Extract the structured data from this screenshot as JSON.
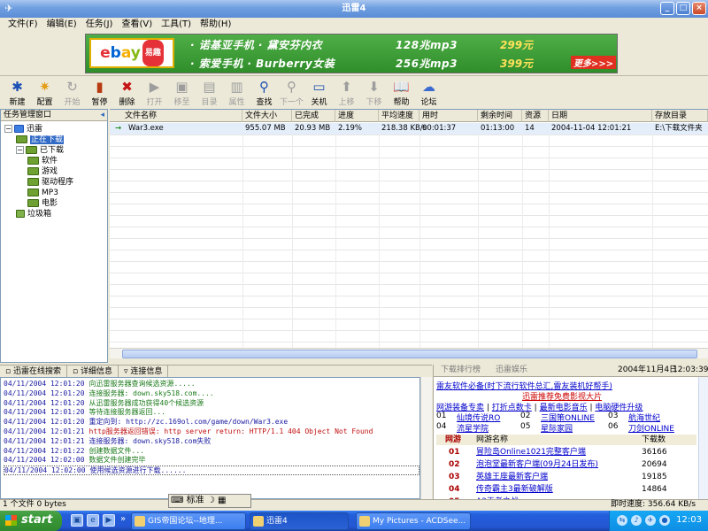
{
  "window": {
    "title": "迅雷4",
    "min": "_",
    "max": "□",
    "close": "×"
  },
  "menu": [
    "文件(F)",
    "编辑(E)",
    "任务(J)",
    "查看(V)",
    "工具(T)",
    "帮助(H)"
  ],
  "ad": {
    "logo_letters": [
      "e",
      "b",
      "a",
      "y"
    ],
    "logo_tag": "易趣",
    "line1": "· 诺基亚手机 · 黛安芬内衣",
    "line1_mp3": "128兆mp3",
    "line1_price": "299元",
    "line2": "· 索爱手机 · Burberry女装",
    "line2_mp3": "256兆mp3",
    "line2_price": "399元",
    "more": "更多>>>"
  },
  "toolbar": [
    {
      "label": "新建",
      "icon": "new-icon",
      "glyph": "✱",
      "enabled": true
    },
    {
      "label": "配置",
      "icon": "config-icon",
      "glyph": "✷",
      "enabled": true
    },
    {
      "label": "开始",
      "icon": "start-icon",
      "glyph": "↻",
      "enabled": false
    },
    {
      "label": "暂停",
      "icon": "pause-icon",
      "glyph": "▮",
      "enabled": true
    },
    {
      "label": "删除",
      "icon": "delete-icon",
      "glyph": "✖",
      "enabled": true
    },
    {
      "label": "打开",
      "icon": "open-icon",
      "glyph": "▶",
      "enabled": false
    },
    {
      "label": "移至",
      "icon": "move-icon",
      "glyph": "▣",
      "enabled": false
    },
    {
      "label": "目录",
      "icon": "folder-icon",
      "glyph": "▤",
      "enabled": false
    },
    {
      "label": "属性",
      "icon": "properties-icon",
      "glyph": "▥",
      "enabled": false
    },
    {
      "label": "查找",
      "icon": "find-icon",
      "glyph": "⚲",
      "enabled": true
    },
    {
      "label": "下一个",
      "icon": "next-icon",
      "glyph": "⚲",
      "enabled": false
    },
    {
      "label": "关机",
      "icon": "shutdown-icon",
      "glyph": "▭",
      "enabled": true
    },
    {
      "label": "上移",
      "icon": "move-up-icon",
      "glyph": "⬆",
      "enabled": false
    },
    {
      "label": "下移",
      "icon": "move-down-icon",
      "glyph": "⬇",
      "enabled": false
    },
    {
      "label": "帮助",
      "icon": "help-icon",
      "glyph": "📖",
      "enabled": true
    },
    {
      "label": "论坛",
      "icon": "forum-icon",
      "glyph": "☁",
      "enabled": true
    }
  ],
  "left": {
    "header": "任务管理窗口",
    "pin": "◂",
    "tree": [
      {
        "label": "迅雷",
        "level": 0,
        "expander": "−"
      },
      {
        "label": "正在下载",
        "level": 1,
        "selected": true
      },
      {
        "label": "已下载",
        "level": 1,
        "expander": "−"
      },
      {
        "label": "软件",
        "level": 2
      },
      {
        "label": "游戏",
        "level": 2
      },
      {
        "label": "驱动程序",
        "level": 2
      },
      {
        "label": "MP3",
        "level": 2
      },
      {
        "label": "电影",
        "level": 2
      },
      {
        "label": "垃圾箱",
        "level": 1
      }
    ]
  },
  "table": {
    "columns": [
      "文件名称",
      "文件大小",
      "已完成",
      "进度",
      "平均速度",
      "用时",
      "剩余时间",
      "资源",
      "日期",
      "存放目录"
    ],
    "rows": [
      [
        "→",
        "War3.exe",
        "955.07 MB",
        "20.93 MB",
        "2.19%",
        "218.38 KB/s",
        "00:01:37",
        "01:13:00",
        "14",
        "2004-11-04 12:01:21",
        "E:\\下载文件夹"
      ]
    ]
  },
  "logtabs": [
    "迅雷在线搜索",
    "详细信息",
    "连接信息"
  ],
  "log": [
    {
      "time": "04/11/2004 12:01:20",
      "msg": "向迅雷服务器查询候选资源.....",
      "color": "green"
    },
    {
      "time": "04/11/2004 12:01:20",
      "msg": "连接服务器: down.sky518.com....",
      "color": "green"
    },
    {
      "time": "04/11/2004 12:01:20",
      "msg": "从迅雷服务器成功获得40个候选资源",
      "color": "green"
    },
    {
      "time": "04/11/2004 12:01:20",
      "msg": "等待连接服务器返回...",
      "color": "green"
    },
    {
      "time": "04/11/2004 12:01:20",
      "msg": "重定向到: http://zc.169ol.com/game/down/War3.exe",
      "color": "blue"
    },
    {
      "time": "04/11/2004 12:01:21",
      "msg": "http服务器返回错误: http server return: HTTP/1.1 404 Object Not Found",
      "color": "red"
    },
    {
      "time": "04/11/2004 12:01:21",
      "msg": "连接服务器: down.sky518.com失败",
      "color": "blue"
    },
    {
      "time": "04/11/2004 12:01:22",
      "msg": "创建数据文件...",
      "color": "green"
    },
    {
      "time": "04/11/2004 12:02:00",
      "msg": "数据文件创建完毕",
      "color": "green"
    },
    {
      "time": "04/11/2004 12:02:00",
      "msg": "使用候选资源进行下载......",
      "color": "blue"
    }
  ],
  "right": {
    "tabs": [
      "下载排行榜",
      "迅雷娱乐"
    ],
    "date": "2004年11月4日",
    "time": "12:03:39",
    "promo1": "雷友软件必备(时下流行软件总汇,雷友装机好帮手)",
    "promo2": "迅雷推荐免费影视大片",
    "links": [
      "网游装备专卖",
      "打折点数卡",
      "最新电影音乐",
      "电脑硬件升级"
    ],
    "grid": [
      [
        "01",
        "仙境传说RO",
        "02",
        "三国策ONLINE",
        "03",
        "航海世纪"
      ],
      [
        "04",
        "流星学院",
        "05",
        "星际家园",
        "06",
        "刀剑ONLINE"
      ]
    ],
    "rank_head": [
      "网游",
      "网游名称",
      "下载数"
    ],
    "ranks": [
      {
        "n": "01",
        "name": "冒险岛Online1021完整客户端",
        "count": "36166"
      },
      {
        "n": "02",
        "name": "泡泡堂最新客户端(09月24日发布)",
        "count": "20694"
      },
      {
        "n": "03",
        "name": "英雄王座最新客户端",
        "count": "19185"
      },
      {
        "n": "04",
        "name": "传奇霸主3最新破解版",
        "count": "14864"
      },
      {
        "n": "05",
        "name": "A3王者之战...",
        "count": ""
      }
    ]
  },
  "status": {
    "left": "1 个文件 0 bytes",
    "right": "即时速度: 356.64 KB/s"
  },
  "ime": {
    "label": "标准"
  },
  "taskbar": {
    "start": "start",
    "tasks": [
      "GIS帝国论坛--地理...",
      "迅雷4",
      "My Pictures - ACDSee..."
    ],
    "clock": "12:03"
  }
}
